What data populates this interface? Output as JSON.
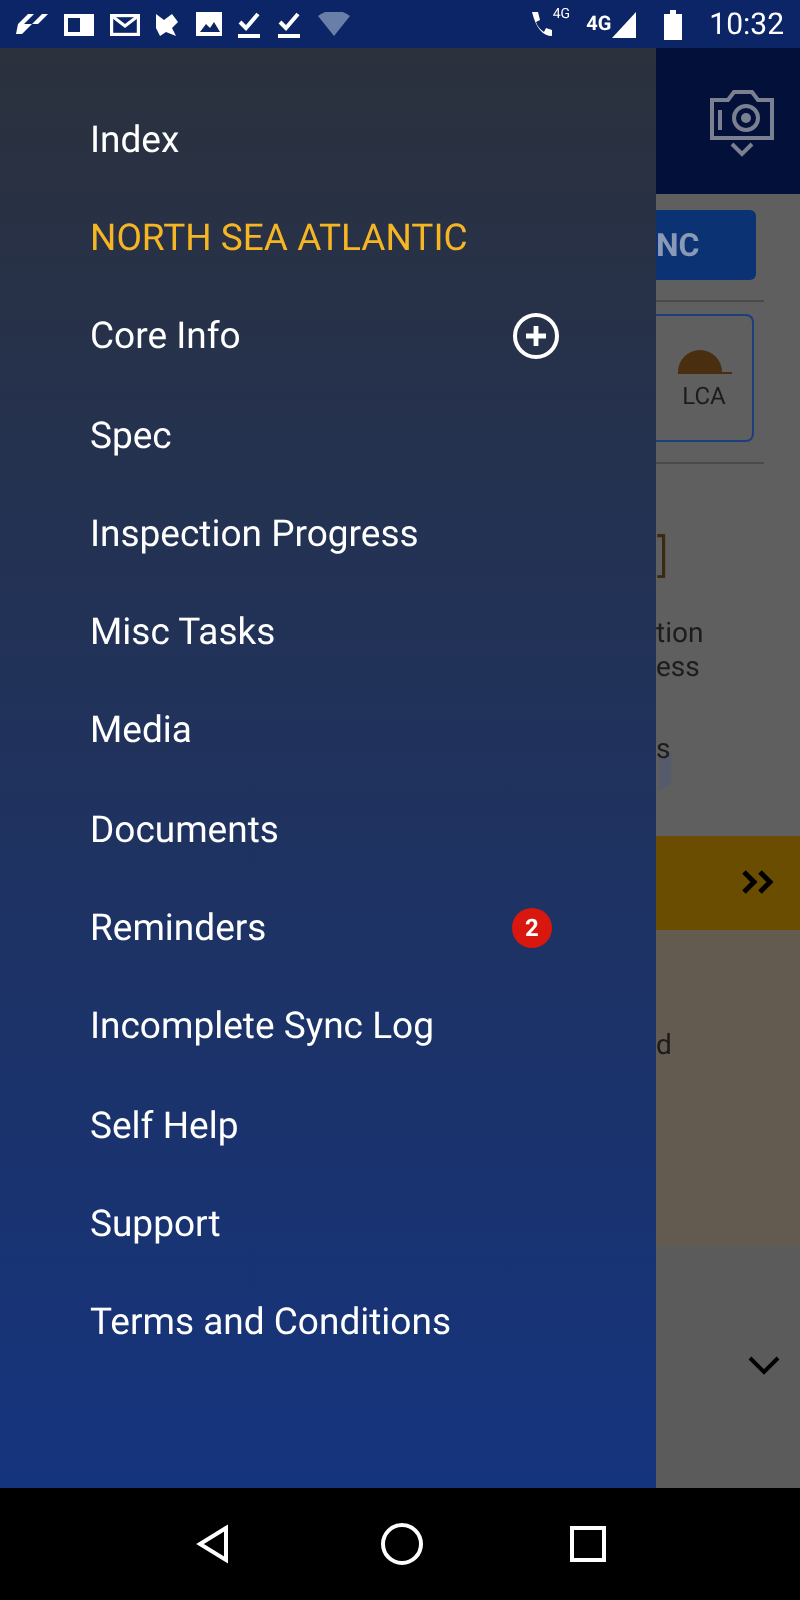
{
  "status_bar": {
    "call_network": "4G",
    "network": "4G",
    "time": "10:32"
  },
  "drawer": {
    "items": [
      {
        "label": "Index",
        "selected": false
      },
      {
        "label": "NORTH SEA ATLANTIC",
        "selected": true
      },
      {
        "label": "Core Info",
        "selected": false,
        "expandable": true
      },
      {
        "label": "Spec",
        "selected": false
      },
      {
        "label": "Inspection Progress",
        "selected": false
      },
      {
        "label": "Misc Tasks",
        "selected": false
      },
      {
        "label": "Media",
        "selected": false
      },
      {
        "label": "Documents",
        "selected": false
      },
      {
        "label": "Reminders",
        "selected": false,
        "badge": "2"
      },
      {
        "label": "Incomplete Sync Log",
        "selected": false
      },
      {
        "label": "Self Help",
        "selected": false
      },
      {
        "label": "Support",
        "selected": false
      },
      {
        "label": "Terms and Conditions",
        "selected": false
      }
    ]
  },
  "background_page": {
    "button_text": "NC",
    "card_label": "LCA",
    "tile_text_1": "tion",
    "tile_text_2": "ess",
    "tile_text_3": "s",
    "panel_text": "d"
  }
}
